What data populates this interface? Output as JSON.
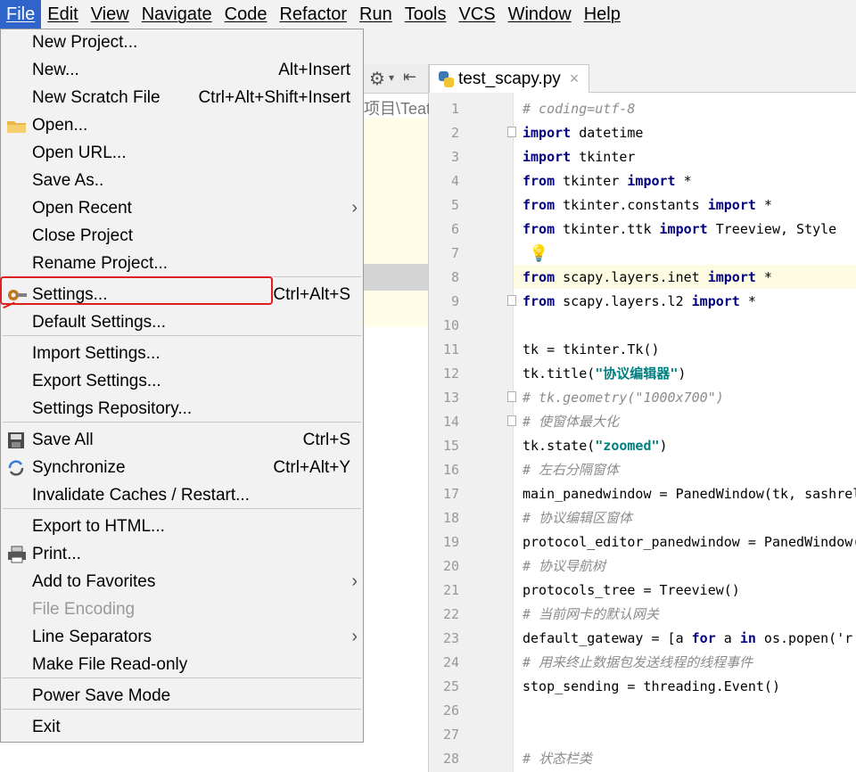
{
  "menubar": {
    "items": [
      "File",
      "Edit",
      "View",
      "Navigate",
      "Code",
      "Refactor",
      "Run",
      "Tools",
      "VCS",
      "Window",
      "Help"
    ]
  },
  "file_menu": {
    "items": [
      {
        "label": "New Project...",
        "shortcut": ""
      },
      {
        "label": "New...",
        "shortcut": "Alt+Insert"
      },
      {
        "label": "New Scratch File",
        "shortcut": "Ctrl+Alt+Shift+Insert"
      },
      {
        "label": "Open...",
        "shortcut": "",
        "icon": "folder-icon"
      },
      {
        "label": "Open URL...",
        "shortcut": ""
      },
      {
        "label": "Save As..",
        "shortcut": ""
      },
      {
        "label": "Open Recent",
        "shortcut": "",
        "submenu": true
      },
      {
        "label": "Close Project",
        "shortcut": ""
      },
      {
        "label": "Rename Project...",
        "shortcut": ""
      },
      {
        "label": "Settings...",
        "shortcut": "Ctrl+Alt+S",
        "icon": "wrench-icon"
      },
      {
        "label": "Default Settings...",
        "shortcut": ""
      },
      {
        "label": "Import Settings...",
        "shortcut": ""
      },
      {
        "label": "Export Settings...",
        "shortcut": ""
      },
      {
        "label": "Settings Repository...",
        "shortcut": ""
      },
      {
        "label": "Save All",
        "shortcut": "Ctrl+S",
        "icon": "save-icon"
      },
      {
        "label": "Synchronize",
        "shortcut": "Ctrl+Alt+Y",
        "icon": "sync-icon"
      },
      {
        "label": "Invalidate Caches / Restart...",
        "shortcut": ""
      },
      {
        "label": "Export to HTML...",
        "shortcut": ""
      },
      {
        "label": "Print...",
        "shortcut": "",
        "icon": "printer-icon"
      },
      {
        "label": "Add to Favorites",
        "shortcut": "",
        "submenu": true
      },
      {
        "label": "File Encoding",
        "shortcut": "",
        "disabled": true
      },
      {
        "label": "Line Separators",
        "shortcut": "",
        "submenu": true
      },
      {
        "label": "Make File Read-only",
        "shortcut": ""
      },
      {
        "label": "Power Save Mode",
        "shortcut": ""
      },
      {
        "label": "Exit",
        "shortcut": ""
      }
    ]
  },
  "project_panel": {
    "path_fragment": "项目\\TeatS"
  },
  "editor": {
    "tab_title": "test_scapy.py",
    "tab_close": "×",
    "line_numbers": [
      "1",
      "2",
      "3",
      "4",
      "5",
      "6",
      "7",
      "8",
      "9",
      "10",
      "11",
      "12",
      "13",
      "14",
      "15",
      "16",
      "17",
      "18",
      "19",
      "20",
      "21",
      "22",
      "23",
      "24",
      "25",
      "26",
      "27",
      "28"
    ],
    "lines": [
      "# coding=utf-8",
      "import datetime",
      "import tkinter",
      "from tkinter import *",
      "from tkinter.constants import *",
      "from tkinter.ttk import Treeview, Style",
      "",
      "from scapy.layers.inet import *",
      "from scapy.layers.l2 import *",
      "",
      "tk = tkinter.Tk()",
      "tk.title(\"协议编辑器\")",
      "# tk.geometry(\"1000x700\")",
      "# 使窗体最大化",
      "tk.state(\"zoomed\")",
      "# 左右分隔窗体",
      "main_panedwindow = PanedWindow(tk, sashrel",
      "# 协议编辑区窗体",
      "protocol_editor_panedwindow = PanedWindow(",
      "# 协议导航树",
      "protocols_tree = Treeview()",
      "# 当前网卡的默认网关",
      "default_gateway = [a for a in os.popen('r",
      "# 用来终止数据包发送线程的线程事件",
      "stop_sending = threading.Event()",
      "",
      "",
      "# 状态栏类"
    ]
  },
  "colors": {
    "menu_highlight": "#2f65ca",
    "keyword": "#000080",
    "comment": "#8c8c8c",
    "string": "#008080",
    "annotation": "#e02020"
  }
}
